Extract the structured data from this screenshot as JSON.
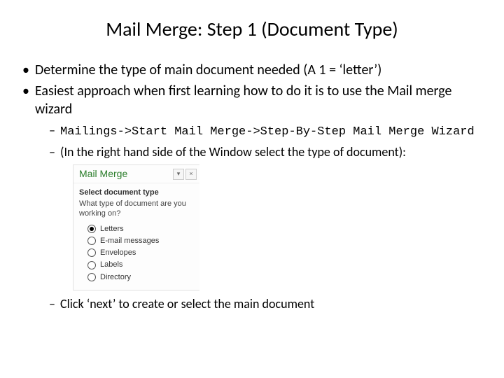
{
  "title": "Mail Merge: Step 1 (Document Type)",
  "bullets": {
    "b1": "Determine the type of main document needed (A 1 = ‘letter’)",
    "b2": "Easiest approach when first learning how to do it is to use the Mail merge wizard",
    "s1": "Mailings->Start Mail Merge->Step-By-Step Mail Merge Wizard",
    "s2": "(In the right hand side of the Window select the type of document):",
    "s3": "Click ‘next’ to create or select the main document"
  },
  "pane": {
    "header": "Mail Merge",
    "dropdown_glyph": "▾",
    "close_glyph": "×",
    "section_title": "Select document type",
    "question": "What type of document are you working on?",
    "options": [
      {
        "label": "Letters",
        "selected": true
      },
      {
        "label": "E-mail messages",
        "selected": false
      },
      {
        "label": "Envelopes",
        "selected": false
      },
      {
        "label": "Labels",
        "selected": false
      },
      {
        "label": "Directory",
        "selected": false
      }
    ]
  }
}
